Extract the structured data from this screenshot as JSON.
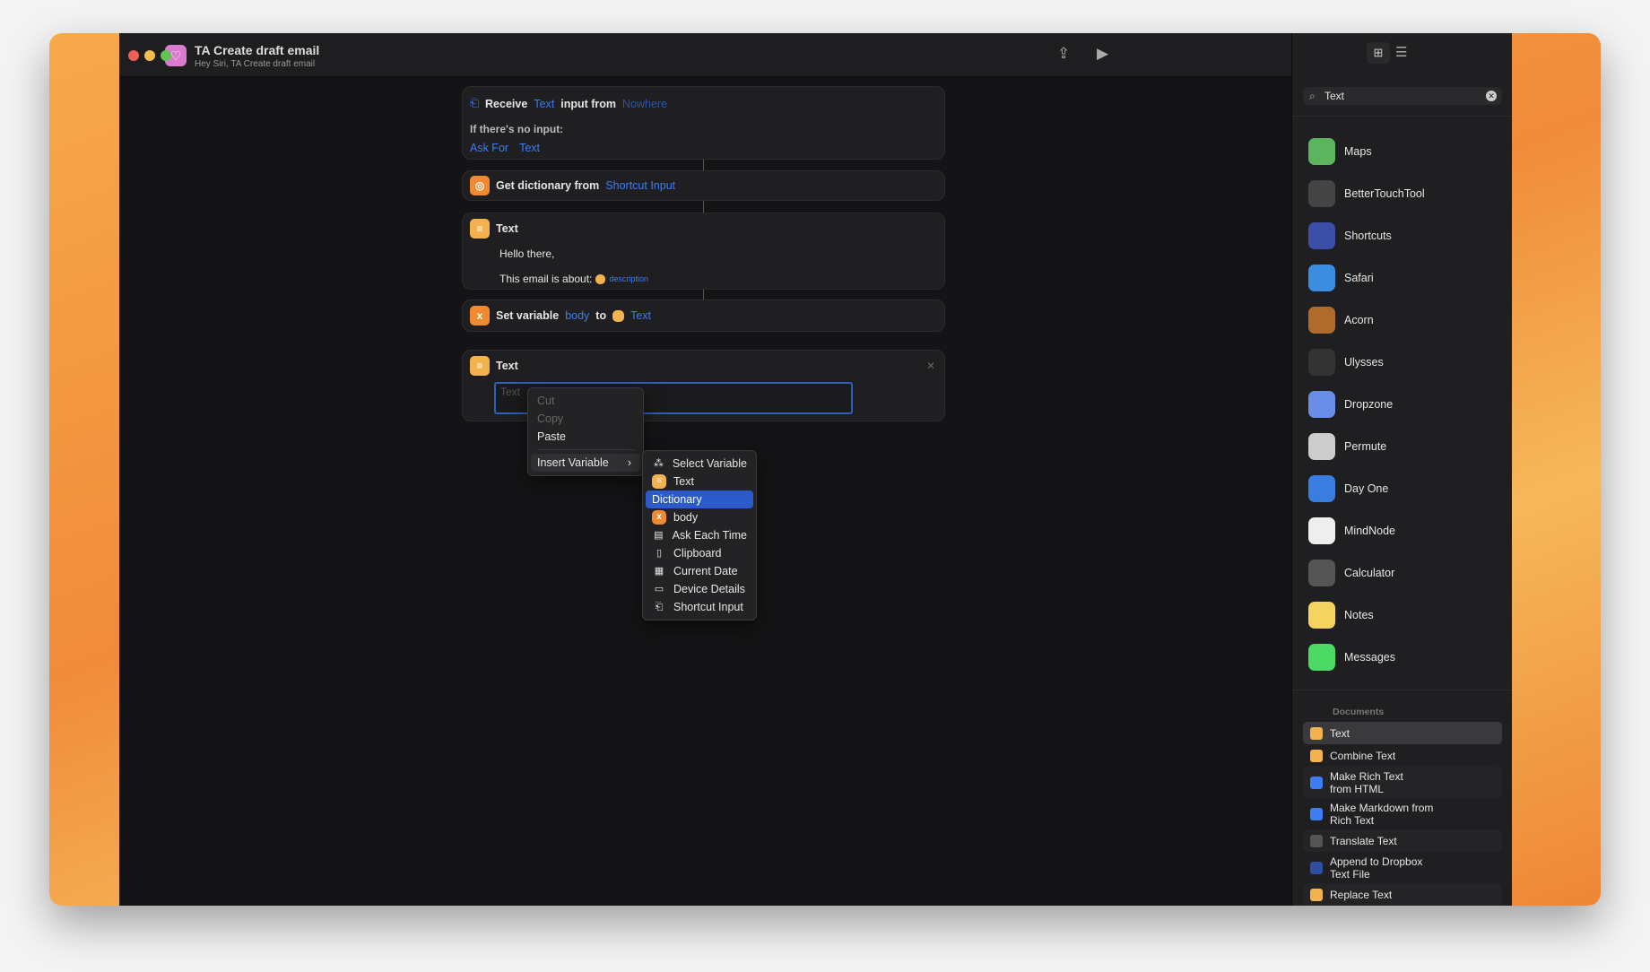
{
  "window": {
    "title": "TA Create draft email",
    "subtitle": "Hey Siri, TA Create draft email"
  },
  "actions": {
    "receive": {
      "label": "Receive",
      "type": "Text",
      "mid": "input from",
      "source": "Nowhere",
      "no_input": "If there's no input:",
      "ask_for": "Ask For",
      "ask_type": "Text"
    },
    "get_dict": {
      "label": "Get dictionary from",
      "source": "Shortcut Input"
    },
    "text1": {
      "label": "Text",
      "line1": "Hello there,",
      "line2": "This email is about:",
      "var": "description"
    },
    "set_var": {
      "label": "Set variable",
      "name": "body",
      "to": "to",
      "value": "Text"
    },
    "text2": {
      "label": "Text",
      "placeholder": "Text"
    }
  },
  "context_menu": {
    "items": [
      "Cut",
      "Copy",
      "Paste"
    ],
    "insert": "Insert Variable"
  },
  "submenu": {
    "items": [
      {
        "label": "Select Variable",
        "icon": "magic-wand-icon"
      },
      {
        "label": "Text",
        "icon": "text-icon"
      },
      {
        "label": "Dictionary",
        "icon": "",
        "selected": true
      },
      {
        "label": "body",
        "icon": "variable-icon"
      },
      {
        "label": "Ask Each Time",
        "icon": "speech-bubble-icon"
      },
      {
        "label": "Clipboard",
        "icon": "clipboard-icon"
      },
      {
        "label": "Current Date",
        "icon": "calendar-icon"
      },
      {
        "label": "Device Details",
        "icon": "monitor-icon"
      },
      {
        "label": "Shortcut Input",
        "icon": "shortcut-input-icon"
      }
    ]
  },
  "sidebar": {
    "search": "Text",
    "apps": [
      {
        "label": "Maps",
        "color": "#5ab55e"
      },
      {
        "label": "BetterTouchTool",
        "color": "#444"
      },
      {
        "label": "Shortcuts",
        "color": "#3c4fa8"
      },
      {
        "label": "Safari",
        "color": "#3a8de0"
      },
      {
        "label": "Acorn",
        "color": "#b06a2a"
      },
      {
        "label": "Ulysses",
        "color": "#333"
      },
      {
        "label": "Dropzone",
        "color": "#6a8ee8"
      },
      {
        "label": "Permute",
        "color": "#ccc"
      },
      {
        "label": "Day One",
        "color": "#3a7de0"
      },
      {
        "label": "MindNode",
        "color": "#eee"
      },
      {
        "label": "Calculator",
        "color": "#555"
      },
      {
        "label": "Notes",
        "color": "#f4d35e"
      },
      {
        "label": "Messages",
        "color": "#4cd964"
      }
    ],
    "section": "Documents",
    "docs": [
      {
        "label": "Text",
        "color": "#f4b24e",
        "selected": true
      },
      {
        "label": "Combine Text",
        "color": "#f4b24e"
      },
      {
        "label": "Make Rich Text\nfrom HTML",
        "color": "#3d7cf5"
      },
      {
        "label": "Make Markdown from\nRich Text",
        "color": "#3d7cf5"
      },
      {
        "label": "Translate Text",
        "color": "#555"
      },
      {
        "label": "Append to Dropbox\nText File",
        "color": "#2d4fa0"
      },
      {
        "label": "Replace Text",
        "color": "#f4b24e"
      }
    ]
  }
}
